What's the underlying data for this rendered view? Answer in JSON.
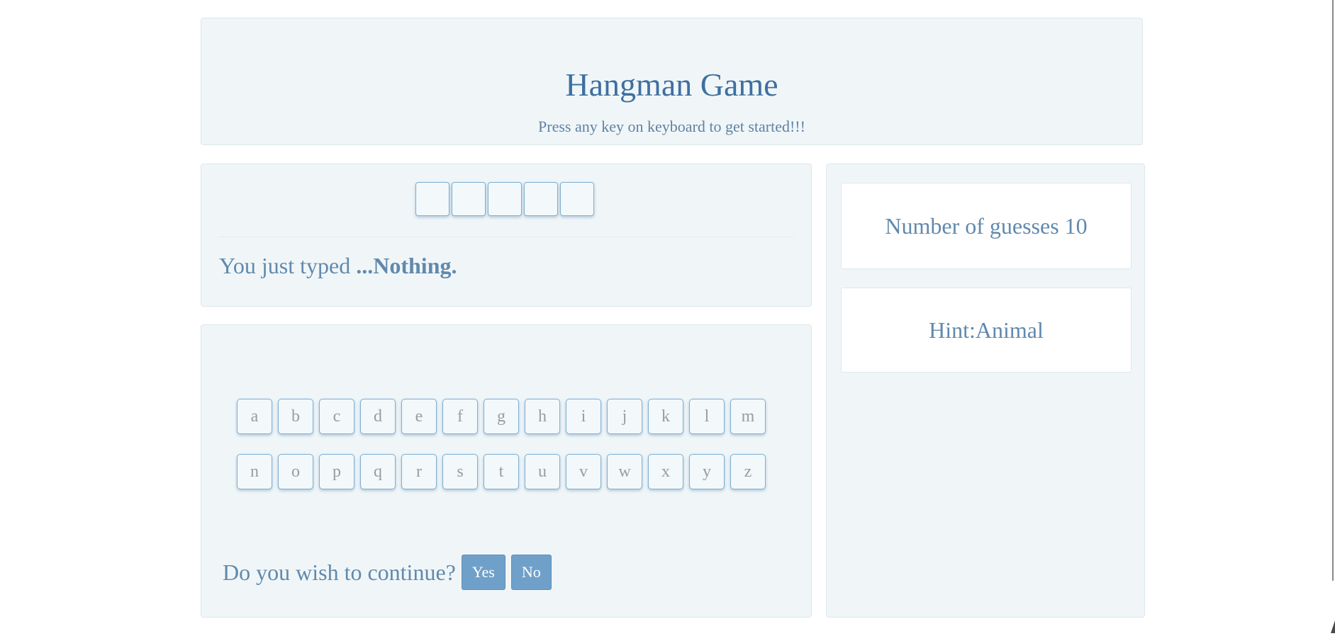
{
  "header": {
    "title": "Hangman Game",
    "subtitle": "Press any key on keyboard to get started!!!"
  },
  "word": {
    "slots": [
      "",
      "",
      "",
      "",
      ""
    ]
  },
  "typed": {
    "prefix": "You just typed ",
    "value": "...Nothing."
  },
  "keyboard": {
    "row1": [
      "a",
      "b",
      "c",
      "d",
      "e",
      "f",
      "g",
      "h",
      "i",
      "j",
      "k",
      "l",
      "m"
    ],
    "row2": [
      "n",
      "o",
      "p",
      "q",
      "r",
      "s",
      "t",
      "u",
      "v",
      "w",
      "x",
      "y",
      "z"
    ]
  },
  "continue": {
    "label": "Do you wish to continue?",
    "yes_label": "Yes",
    "no_label": "No"
  },
  "side": {
    "guesses_text": "Number of guesses 10",
    "hint_text": "Hint:Animal"
  },
  "colors": {
    "accent": "#3f6fa0",
    "button": "#6fa0c9",
    "panel": "#f0f6f8"
  }
}
